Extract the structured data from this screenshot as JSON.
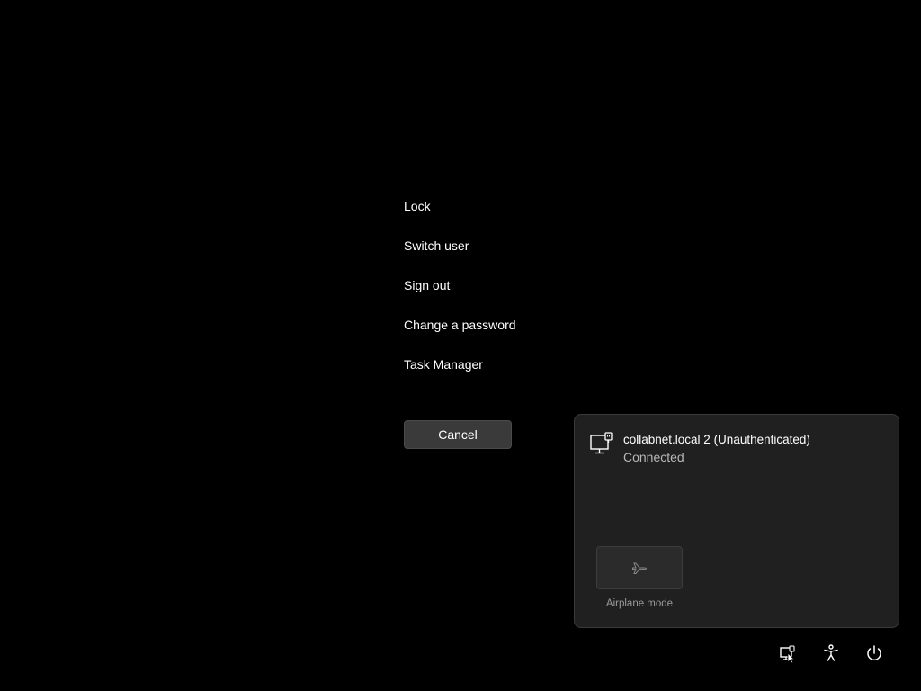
{
  "security_menu": {
    "items": [
      {
        "id": "lock",
        "label": "Lock"
      },
      {
        "id": "switch-user",
        "label": "Switch user"
      },
      {
        "id": "sign-out",
        "label": "Sign out"
      },
      {
        "id": "change-password",
        "label": "Change a password"
      },
      {
        "id": "task-manager",
        "label": "Task Manager"
      }
    ],
    "cancel_label": "Cancel"
  },
  "network_flyout": {
    "network": {
      "name": "collabnet.local 2 (Unauthenticated)",
      "status": "Connected",
      "icon": "ethernet-monitor-icon"
    },
    "airplane_mode": {
      "label": "Airplane mode",
      "icon": "airplane-icon",
      "enabled": false
    }
  },
  "tray": {
    "icons": [
      "network-icon",
      "accessibility-icon",
      "power-icon"
    ]
  },
  "colors": {
    "background": "#000000",
    "flyout_bg": "#202020",
    "button_bg": "#3a3a3a",
    "text_primary": "#ffffff",
    "text_secondary": "#b8b8b8"
  }
}
